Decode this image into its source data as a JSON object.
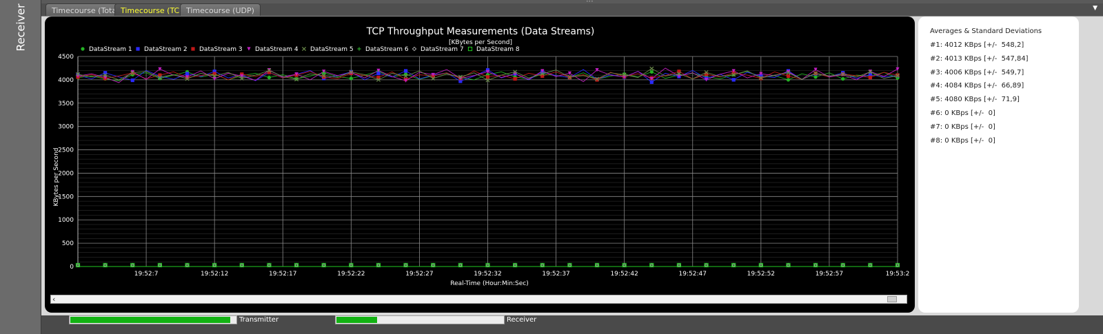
{
  "sidebar": {
    "label": "Receiver"
  },
  "tabs": [
    {
      "label": "Timecourse (Total)",
      "active": false
    },
    {
      "label": "Timecourse (TCP)",
      "active": true
    },
    {
      "label": "Timecourse (UDP)",
      "active": false
    }
  ],
  "icons": {
    "menu": "chevron-down-icon",
    "scroll_left": "arrow-left-icon"
  },
  "chart_data": {
    "type": "line",
    "title": "TCP Throughput Measurements (Data Streams)",
    "subtitle": "[KBytes per Second]",
    "xlabel": "Real-Time (Hour:Min:Sec)",
    "ylabel": "KBytes per Second",
    "ylim": [
      0,
      4500
    ],
    "y_ticks": [
      0,
      500,
      1000,
      1500,
      2000,
      2500,
      3000,
      3500,
      4000,
      4500
    ],
    "x_ticks": [
      "19:52:7",
      "19:52:12",
      "19:52:17",
      "19:52:22",
      "19:52:27",
      "19:52:32",
      "19:52:37",
      "19:52:42",
      "19:52:47",
      "19:52:52",
      "19:52:57",
      "19:53:2"
    ],
    "x_range_seconds": [
      2,
      62
    ],
    "grid": true,
    "legend_position": "top-left",
    "series": [
      {
        "name": "DataStream 1",
        "color": "#23b223",
        "marker": "circle",
        "values": [
          4050,
          4080,
          4020,
          3980,
          4110,
          4150,
          4030,
          4100,
          4170,
          4060,
          4120,
          4000,
          4090,
          4140,
          4050,
          4110,
          4020,
          4080,
          4150,
          4070,
          4030,
          4100,
          4180,
          4060,
          4120,
          4010,
          4090,
          4140,
          4050,
          4000,
          4110,
          4170,
          4060,
          4020,
          4130,
          4090,
          4050,
          4150,
          4010,
          4080,
          4120,
          4060,
          4170,
          4030,
          4100,
          4140,
          4070,
          4020,
          4110,
          4180,
          4050,
          4090,
          4000,
          4130,
          4060,
          4150,
          4020,
          4100,
          4080,
          4160,
          4040
        ]
      },
      {
        "name": "DataStream 2",
        "color": "#2a2aff",
        "marker": "square",
        "values": [
          4100,
          4020,
          4150,
          4060,
          3990,
          4200,
          4080,
          4010,
          4130,
          4070,
          4180,
          4040,
          4110,
          3980,
          4160,
          4050,
          4120,
          4200,
          4030,
          4090,
          4170,
          4000,
          4140,
          4060,
          4190,
          4020,
          4100,
          4150,
          3970,
          4080,
          4210,
          4040,
          4130,
          4000,
          4170,
          4090,
          4050,
          4220,
          4010,
          4110,
          4060,
          4180,
          3950,
          4140,
          4070,
          4200,
          4030,
          4120,
          4000,
          4160,
          4080,
          4050,
          4190,
          4010,
          4130,
          4070,
          4150,
          4030,
          4110,
          4060,
          4090
        ]
      },
      {
        "name": "DataStream 3",
        "color": "#c01818",
        "marker": "square",
        "values": [
          4060,
          4110,
          4030,
          4080,
          4150,
          4020,
          4100,
          4170,
          4050,
          4090,
          4130,
          4000,
          4120,
          4070,
          4160,
          4040,
          4100,
          4180,
          4060,
          4020,
          4140,
          4090,
          4050,
          4170,
          4010,
          4110,
          4080,
          4150,
          4030,
          4190,
          4060,
          4100,
          4020,
          4140,
          4080,
          4170,
          4050,
          4110,
          4000,
          4160,
          4070,
          4130,
          4040,
          4090,
          4180,
          4020,
          4120,
          4060,
          4150,
          4100,
          4030,
          4170,
          4080,
          4010,
          4140,
          4060,
          4120,
          4090,
          4050,
          4160,
          4100
        ]
      },
      {
        "name": "DataStream 4",
        "color": "#c020c0",
        "marker": "triangle-down",
        "values": [
          4080,
          4130,
          4050,
          3940,
          4170,
          4010,
          4230,
          4100,
          4060,
          4190,
          4020,
          4140,
          4080,
          3990,
          4210,
          4060,
          4120,
          4000,
          4180,
          4090,
          4150,
          4040,
          4200,
          4070,
          3980,
          4160,
          4110,
          4220,
          4030,
          4090,
          4170,
          4050,
          4130,
          4010,
          4190,
          4070,
          4140,
          3960,
          4210,
          4100,
          4060,
          4180,
          4020,
          4250,
          4080,
          4150,
          4000,
          4120,
          4190,
          4040,
          4130,
          4090,
          4170,
          4010,
          4220,
          4060,
          4110,
          4000,
          4180,
          4070,
          4230
        ]
      },
      {
        "name": "DataStream 5",
        "color": "#6a8a4a",
        "marker": "x",
        "values": [
          4120,
          4060,
          4100,
          4000,
          4150,
          4180,
          4050,
          4110,
          4020,
          4140,
          4080,
          4160,
          4030,
          4100,
          4200,
          4070,
          4010,
          4130,
          4090,
          4050,
          4170,
          4110,
          4000,
          4140,
          4080,
          4190,
          4030,
          4120,
          4060,
          4150,
          3990,
          4100,
          4170,
          4040,
          4130,
          4210,
          4060,
          4090,
          4020,
          4150,
          4110,
          4050,
          4240,
          4080,
          4130,
          4020,
          4160,
          4070,
          4110,
          4190,
          4040,
          4100,
          4150,
          4010,
          4140,
          4080,
          4120,
          4060,
          4170,
          4030,
          4090
        ]
      },
      {
        "name": "DataStream 6",
        "color": "#2ea02e",
        "marker": "plus",
        "values": [
          0,
          0,
          0,
          0,
          0,
          0,
          0,
          0,
          0,
          0,
          0,
          0,
          0,
          0,
          0,
          0,
          0,
          0,
          0,
          0,
          0,
          0,
          0,
          0,
          0,
          0,
          0,
          0,
          0,
          0,
          0,
          0,
          0,
          0,
          0,
          0,
          0,
          0,
          0,
          0,
          0,
          0,
          0,
          0,
          0,
          0,
          0,
          0,
          0,
          0,
          0,
          0,
          0,
          0,
          0,
          0,
          0,
          0,
          0,
          0,
          0
        ]
      },
      {
        "name": "DataStream 7",
        "color": "#aaaaaa",
        "marker": "diamond",
        "values": [
          0,
          0,
          0,
          0,
          0,
          0,
          0,
          0,
          0,
          0,
          0,
          0,
          0,
          0,
          0,
          0,
          0,
          0,
          0,
          0,
          0,
          0,
          0,
          0,
          0,
          0,
          0,
          0,
          0,
          0,
          0,
          0,
          0,
          0,
          0,
          0,
          0,
          0,
          0,
          0,
          0,
          0,
          0,
          0,
          0,
          0,
          0,
          0,
          0,
          0,
          0,
          0,
          0,
          0,
          0,
          0,
          0,
          0,
          0,
          0,
          0
        ]
      },
      {
        "name": "DataStream 8",
        "color": "#22cc22",
        "marker": "square-open",
        "values": [
          0,
          0,
          0,
          0,
          0,
          0,
          0,
          0,
          0,
          0,
          0,
          0,
          0,
          0,
          0,
          0,
          0,
          0,
          0,
          0,
          0,
          0,
          0,
          0,
          0,
          0,
          0,
          0,
          0,
          0,
          0,
          0,
          0,
          0,
          0,
          0,
          0,
          0,
          0,
          0,
          0,
          0,
          0,
          0,
          0,
          0,
          0,
          0,
          0,
          0,
          0,
          0,
          0,
          0,
          0,
          0,
          0,
          0,
          0,
          0,
          0
        ]
      }
    ]
  },
  "stats": {
    "title": "Averages & Standard Deviations",
    "lines": [
      "#1: 4012 KBps [+/-  548,2]",
      "#2: 4013 KBps [+/-  547,84]",
      "#3: 4006 KBps [+/-  549,7]",
      "#4: 4084 KBps [+/-  66,89]",
      "#5: 4080 KBps [+/-  71,9]",
      "#6: 0 KBps [+/-  0]",
      "#7: 0 KBps [+/-  0]",
      "#8: 0 KBps [+/-  0]"
    ]
  },
  "status": {
    "transmitter": {
      "label": "Transmitter",
      "level": 0.96
    },
    "receiver": {
      "label": "Receiver",
      "level": 0.24
    }
  }
}
